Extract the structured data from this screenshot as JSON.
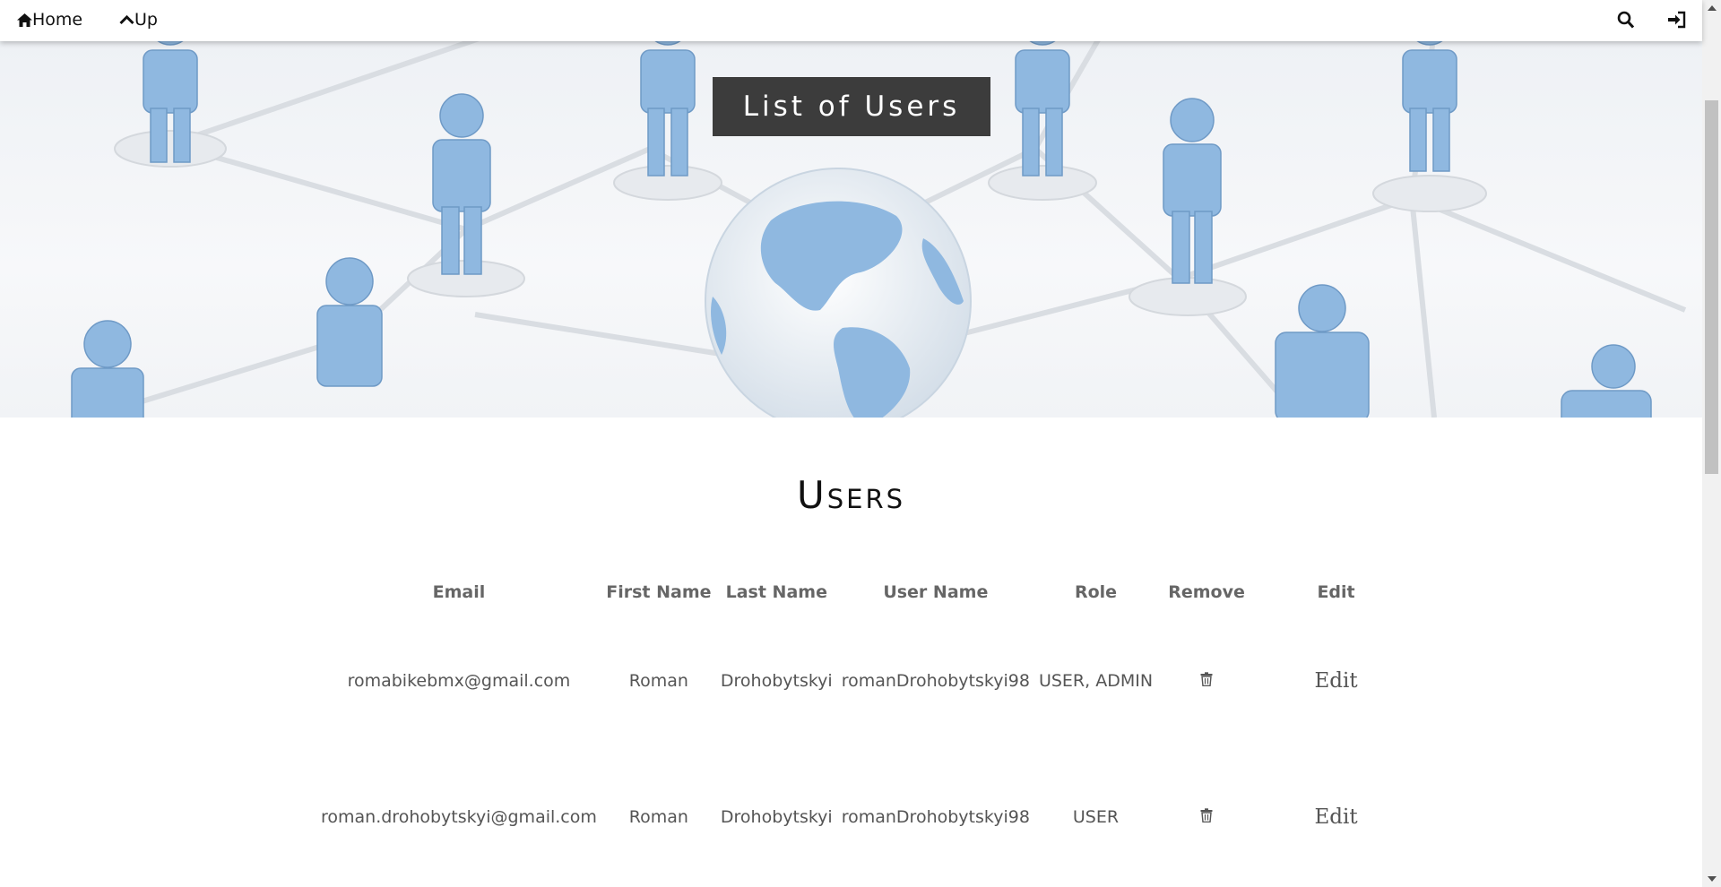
{
  "nav": {
    "home_label": "Home",
    "up_label": "Up",
    "icons": {
      "home": "home-icon",
      "up": "chevron-up-icon",
      "search": "search-icon",
      "signin": "sign-in-icon"
    }
  },
  "hero": {
    "title": "List of Users"
  },
  "section": {
    "heading": "Users"
  },
  "table": {
    "headers": [
      "Email",
      "First Name",
      "Last Name",
      "User Name",
      "Role",
      "Remove",
      "Edit"
    ],
    "rows": [
      {
        "email": "romabikebmx@gmail.com",
        "first_name": "Roman",
        "last_name": "Drohobytskyi",
        "user_name": "romanDrohobytskyi98",
        "role": "USER, ADMIN",
        "edit": "Edit"
      },
      {
        "email": "roman.drohobytskyi@gmail.com",
        "first_name": "Roman",
        "last_name": "Drohobytskyi",
        "user_name": "romanDrohobytskyi98",
        "role": "USER",
        "edit": "Edit"
      }
    ]
  },
  "colors": {
    "title_bg": "#3c3c3c",
    "figure": "#8fb8e0",
    "text": "#555555"
  }
}
